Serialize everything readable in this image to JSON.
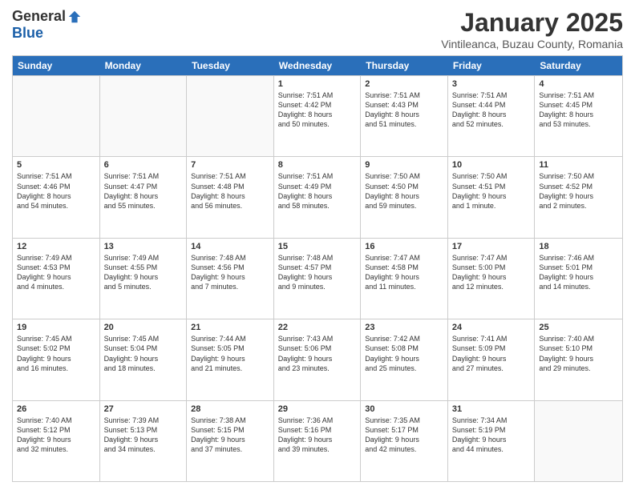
{
  "header": {
    "logo_general": "General",
    "logo_blue": "Blue",
    "title": "January 2025",
    "location": "Vintileanca, Buzau County, Romania"
  },
  "days_of_week": [
    "Sunday",
    "Monday",
    "Tuesday",
    "Wednesday",
    "Thursday",
    "Friday",
    "Saturday"
  ],
  "weeks": [
    [
      {
        "day": "",
        "content": ""
      },
      {
        "day": "",
        "content": ""
      },
      {
        "day": "",
        "content": ""
      },
      {
        "day": "1",
        "content": "Sunrise: 7:51 AM\nSunset: 4:42 PM\nDaylight: 8 hours\nand 50 minutes."
      },
      {
        "day": "2",
        "content": "Sunrise: 7:51 AM\nSunset: 4:43 PM\nDaylight: 8 hours\nand 51 minutes."
      },
      {
        "day": "3",
        "content": "Sunrise: 7:51 AM\nSunset: 4:44 PM\nDaylight: 8 hours\nand 52 minutes."
      },
      {
        "day": "4",
        "content": "Sunrise: 7:51 AM\nSunset: 4:45 PM\nDaylight: 8 hours\nand 53 minutes."
      }
    ],
    [
      {
        "day": "5",
        "content": "Sunrise: 7:51 AM\nSunset: 4:46 PM\nDaylight: 8 hours\nand 54 minutes."
      },
      {
        "day": "6",
        "content": "Sunrise: 7:51 AM\nSunset: 4:47 PM\nDaylight: 8 hours\nand 55 minutes."
      },
      {
        "day": "7",
        "content": "Sunrise: 7:51 AM\nSunset: 4:48 PM\nDaylight: 8 hours\nand 56 minutes."
      },
      {
        "day": "8",
        "content": "Sunrise: 7:51 AM\nSunset: 4:49 PM\nDaylight: 8 hours\nand 58 minutes."
      },
      {
        "day": "9",
        "content": "Sunrise: 7:50 AM\nSunset: 4:50 PM\nDaylight: 8 hours\nand 59 minutes."
      },
      {
        "day": "10",
        "content": "Sunrise: 7:50 AM\nSunset: 4:51 PM\nDaylight: 9 hours\nand 1 minute."
      },
      {
        "day": "11",
        "content": "Sunrise: 7:50 AM\nSunset: 4:52 PM\nDaylight: 9 hours\nand 2 minutes."
      }
    ],
    [
      {
        "day": "12",
        "content": "Sunrise: 7:49 AM\nSunset: 4:53 PM\nDaylight: 9 hours\nand 4 minutes."
      },
      {
        "day": "13",
        "content": "Sunrise: 7:49 AM\nSunset: 4:55 PM\nDaylight: 9 hours\nand 5 minutes."
      },
      {
        "day": "14",
        "content": "Sunrise: 7:48 AM\nSunset: 4:56 PM\nDaylight: 9 hours\nand 7 minutes."
      },
      {
        "day": "15",
        "content": "Sunrise: 7:48 AM\nSunset: 4:57 PM\nDaylight: 9 hours\nand 9 minutes."
      },
      {
        "day": "16",
        "content": "Sunrise: 7:47 AM\nSunset: 4:58 PM\nDaylight: 9 hours\nand 11 minutes."
      },
      {
        "day": "17",
        "content": "Sunrise: 7:47 AM\nSunset: 5:00 PM\nDaylight: 9 hours\nand 12 minutes."
      },
      {
        "day": "18",
        "content": "Sunrise: 7:46 AM\nSunset: 5:01 PM\nDaylight: 9 hours\nand 14 minutes."
      }
    ],
    [
      {
        "day": "19",
        "content": "Sunrise: 7:45 AM\nSunset: 5:02 PM\nDaylight: 9 hours\nand 16 minutes."
      },
      {
        "day": "20",
        "content": "Sunrise: 7:45 AM\nSunset: 5:04 PM\nDaylight: 9 hours\nand 18 minutes."
      },
      {
        "day": "21",
        "content": "Sunrise: 7:44 AM\nSunset: 5:05 PM\nDaylight: 9 hours\nand 21 minutes."
      },
      {
        "day": "22",
        "content": "Sunrise: 7:43 AM\nSunset: 5:06 PM\nDaylight: 9 hours\nand 23 minutes."
      },
      {
        "day": "23",
        "content": "Sunrise: 7:42 AM\nSunset: 5:08 PM\nDaylight: 9 hours\nand 25 minutes."
      },
      {
        "day": "24",
        "content": "Sunrise: 7:41 AM\nSunset: 5:09 PM\nDaylight: 9 hours\nand 27 minutes."
      },
      {
        "day": "25",
        "content": "Sunrise: 7:40 AM\nSunset: 5:10 PM\nDaylight: 9 hours\nand 29 minutes."
      }
    ],
    [
      {
        "day": "26",
        "content": "Sunrise: 7:40 AM\nSunset: 5:12 PM\nDaylight: 9 hours\nand 32 minutes."
      },
      {
        "day": "27",
        "content": "Sunrise: 7:39 AM\nSunset: 5:13 PM\nDaylight: 9 hours\nand 34 minutes."
      },
      {
        "day": "28",
        "content": "Sunrise: 7:38 AM\nSunset: 5:15 PM\nDaylight: 9 hours\nand 37 minutes."
      },
      {
        "day": "29",
        "content": "Sunrise: 7:36 AM\nSunset: 5:16 PM\nDaylight: 9 hours\nand 39 minutes."
      },
      {
        "day": "30",
        "content": "Sunrise: 7:35 AM\nSunset: 5:17 PM\nDaylight: 9 hours\nand 42 minutes."
      },
      {
        "day": "31",
        "content": "Sunrise: 7:34 AM\nSunset: 5:19 PM\nDaylight: 9 hours\nand 44 minutes."
      },
      {
        "day": "",
        "content": ""
      }
    ]
  ]
}
